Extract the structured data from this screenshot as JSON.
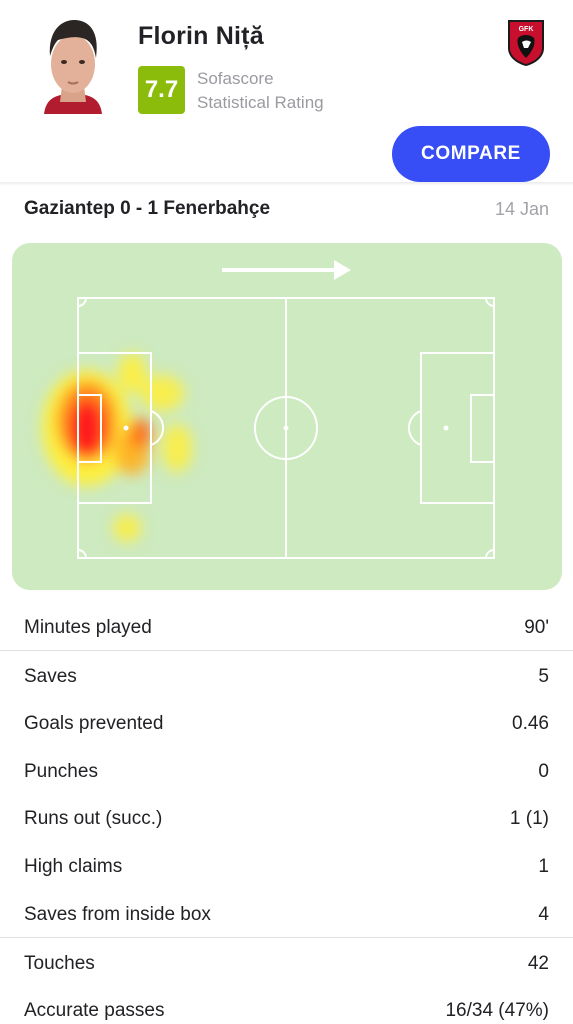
{
  "player": {
    "name": "Florin Niță",
    "rating": "7.7",
    "rating_source": "Sofascore",
    "rating_type": "Statistical Rating",
    "crest_text": "GFK"
  },
  "compare_label": "COMPARE",
  "match": {
    "title": "Gaziantep 0 - 1 Fenerbahçe",
    "date": "14 Jan"
  },
  "colors": {
    "accent": "#374df5",
    "rating_badge": "#8cbc0b",
    "pitch": "#cdeac0",
    "heat_hot": "#ff1a1a",
    "heat_warm": "#ffef3a"
  },
  "heatmap": {
    "attack_direction": "right"
  },
  "stats": [
    {
      "label": "Minutes played",
      "value": "90'"
    },
    {
      "label": "Saves",
      "value": "5"
    },
    {
      "label": "Goals prevented",
      "value": "0.46"
    },
    {
      "label": "Punches",
      "value": "0"
    },
    {
      "label": "Runs out (succ.)",
      "value": "1 (1)"
    },
    {
      "label": "High claims",
      "value": "1"
    },
    {
      "label": "Saves from inside box",
      "value": "4"
    },
    {
      "label": "Touches",
      "value": "42"
    },
    {
      "label": "Accurate passes",
      "value": "16/34 (47%)"
    }
  ]
}
